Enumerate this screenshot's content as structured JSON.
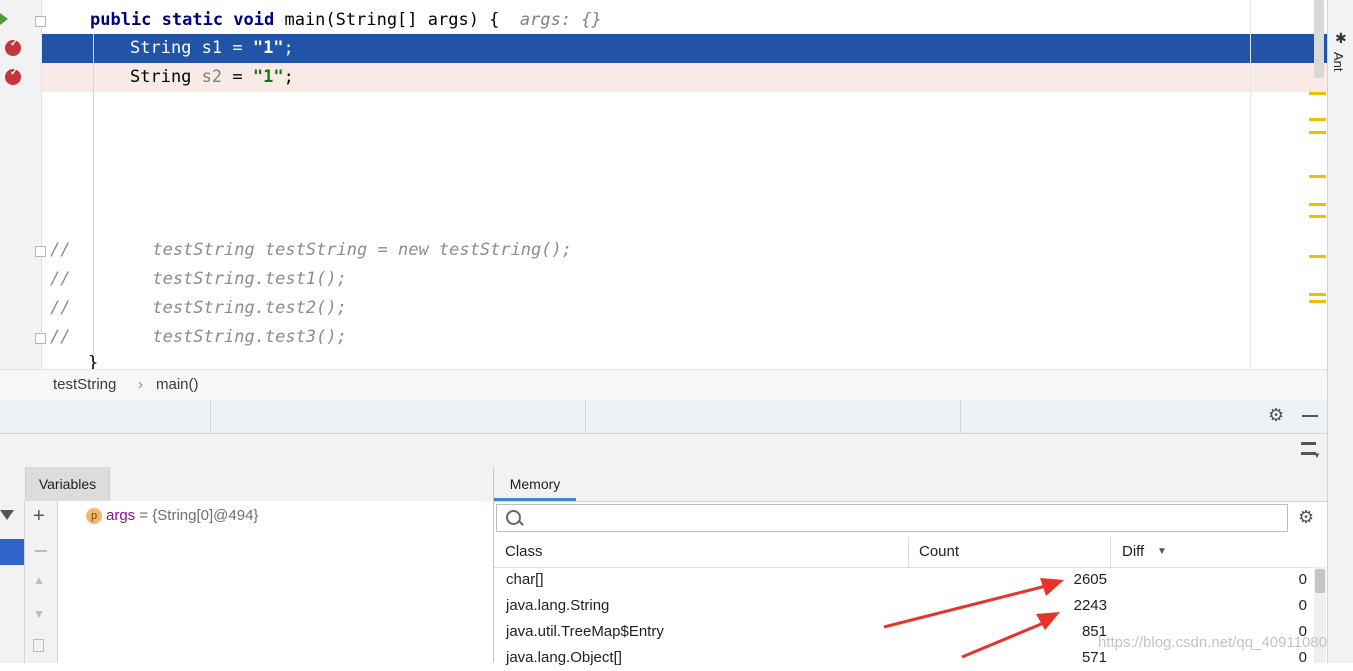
{
  "editor": {
    "line_main": {
      "kw": "public static void",
      "rest": " main(String[] args) {  ",
      "hint": "args: {}"
    },
    "line_s1": {
      "type": "String s1 = ",
      "str": "\"1\"",
      "end": ";"
    },
    "line_s2": {
      "type": "String ",
      "var": "s2",
      "mid": " = ",
      "str": "\"1\"",
      "end": ";"
    },
    "comments": [
      "//        testString testString = new testString();",
      "//        testString.test1();",
      "//        testString.test2();",
      "//        testString.test3();"
    ],
    "closing_brace": "}",
    "colors": {
      "selection": "#2154a6",
      "breakpoint_row": "#faeae6",
      "keyword": "#000080",
      "string": "#067d17"
    }
  },
  "side_tool": {
    "label": "Ant"
  },
  "breadcrumb": {
    "class": "testString",
    "method": "main()"
  },
  "debug": {
    "variables_tab": "Variables",
    "memory_tab": "Memory",
    "variables": [
      {
        "badge": "p",
        "name": "args",
        "value": "= {String[0]@494}"
      }
    ],
    "memory": {
      "search_placeholder": "",
      "columns": {
        "class": "Class",
        "count": "Count",
        "diff": "Diff"
      },
      "rows": [
        {
          "class": "char[]",
          "count": "2605",
          "diff": "0"
        },
        {
          "class": "java.lang.String",
          "count": "2243",
          "diff": "0"
        },
        {
          "class": "java.util.TreeMap$Entry",
          "count": "851",
          "diff": "0"
        },
        {
          "class": "java.lang.Object[]",
          "count": "571",
          "diff": "0"
        }
      ]
    }
  },
  "watermark": "https://blog.csdn.net/qq_40911080"
}
